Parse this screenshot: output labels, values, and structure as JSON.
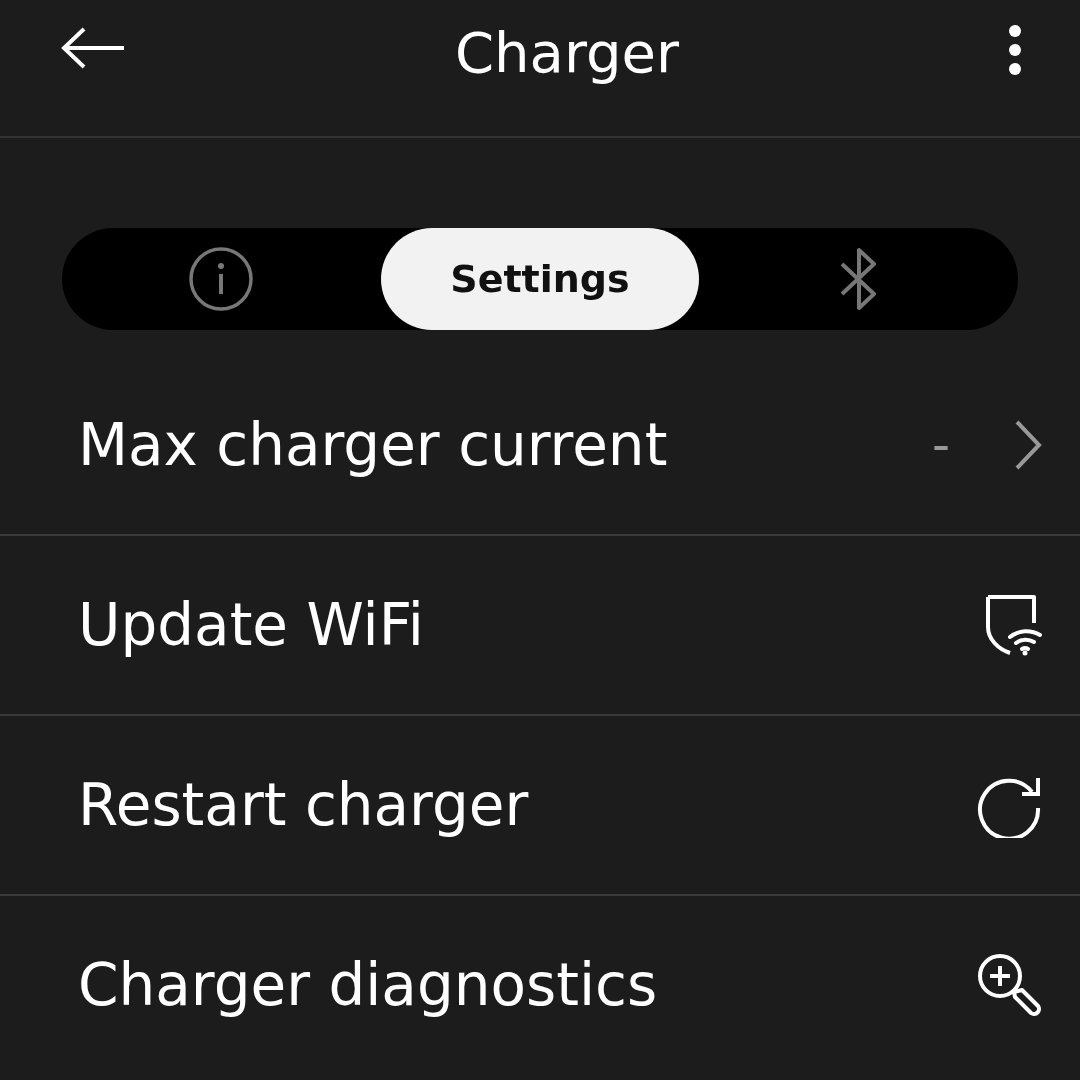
{
  "header": {
    "title": "Charger"
  },
  "tabs": [
    {
      "kind": "info",
      "selected": false
    },
    {
      "kind": "text",
      "label": "Settings",
      "selected": true
    },
    {
      "kind": "bluetooth",
      "selected": false
    }
  ],
  "rows": [
    {
      "kind": "value",
      "label": "Max charger current",
      "value": "-"
    },
    {
      "kind": "wifi",
      "label": "Update WiFi"
    },
    {
      "kind": "restart",
      "label": "Restart charger"
    },
    {
      "kind": "diagnostics",
      "label": "Charger diagnostics"
    }
  ]
}
